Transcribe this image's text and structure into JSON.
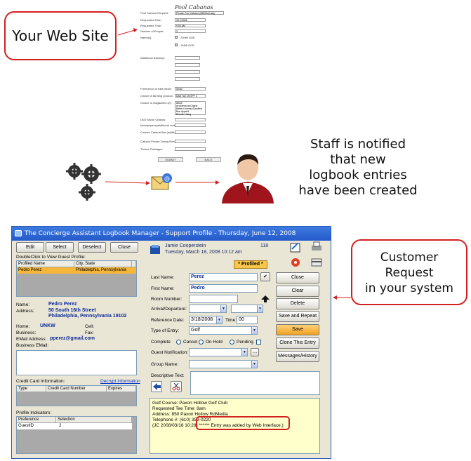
{
  "callouts": {
    "web_site": "Your Web Site",
    "staff_notice": [
      "Staff is notified",
      "that new",
      "logbook entries",
      "have been created"
    ],
    "customer_request": [
      "Customer",
      "Request",
      "in your system"
    ]
  },
  "webform": {
    "title": "Pool Cabanas",
    "fields": [
      {
        "label": "Pool Cabana Request:",
        "value": "Private Pool Cabana ($350/full day)"
      },
      {
        "label": "Requested Date:",
        "value": "3/17/2008"
      },
      {
        "label": "Requested Time:",
        "value": "9:00 AM"
      },
      {
        "label": "Number of People:",
        "value": "3"
      },
      {
        "label": "Name(s):",
        "value": "JOHN DOE"
      },
      {
        "label": "",
        "value": "JANE DOE"
      },
      {
        "label": "Additional Name(s):",
        "value": ""
      },
      {
        "label": "Preference of tribe mixer:",
        "value": "Small"
      },
      {
        "label": "Choice of tanning product:",
        "value": "Dark Tan Oil SPF 2"
      },
      {
        "label": "Choice of magazines (2):",
        "value": "Allure"
      },
      {
        "label": "DVD Movie Options:",
        "value": ""
      },
      {
        "label": "Newspapers(additional cost):",
        "value": ""
      },
      {
        "label": "Custom Cabana Bar (additional cost):",
        "value": ""
      },
      {
        "label": "Cabana Private Dining Menu:",
        "value": ""
      },
      {
        "label": "Theme Packages:",
        "value": ""
      }
    ],
    "magazines": [
      "Allure",
      "Architectural Digest",
      "Better Homes&Gardens",
      "Bon Appetit",
      "Bonnie Living"
    ],
    "submit_label": "SUBMIT",
    "back_label": "BACK"
  },
  "app": {
    "window_title": "The Concierge Assistant Logbook Manager - Support Profile - Thursday, June 12, 2008",
    "left": {
      "buttons": {
        "edit": "Edit",
        "select": "Select",
        "deselect": "Deselect",
        "close": "Close"
      },
      "profile_hint": "DoubleClick to View Guest Profile:",
      "profile_columns": [
        "Profiled Name",
        "City, State"
      ],
      "profile_rows": [
        {
          "name": "Pedro Perez",
          "city": "Philadelphia, Pennsylvania"
        }
      ],
      "name_label": "Name:",
      "name_value": "Pedro Perez",
      "address_label": "Address:",
      "address_line1": "50 South 16th Street",
      "address_line2": "Philadelphia, Pennsylvania   19102",
      "home_label": "Home:",
      "home_value": "UNKW",
      "cell_label": "Cell:",
      "business_label": "Business:",
      "fax_label": "Fax:",
      "email_label": "EMail Address:",
      "email_value": "pperez@gmail.com",
      "business_email_label": "Business EMail:",
      "cc_label": "Credit Card Information:",
      "cc_link": "Decrypt Information",
      "cc_columns": [
        "Type",
        "Credit Card Number",
        "Expires"
      ],
      "indicators_label": "Profile Indicators:",
      "indicator_columns": [
        "Preference",
        "Selection"
      ],
      "indicator_rows": [
        {
          "pref": "GuestID",
          "sel": "2"
        }
      ]
    },
    "right": {
      "user": "Jamie Cooperstein",
      "date": "Tuesday, March 18, 2008   10:12 am",
      "entry_number": "118",
      "profiled_badge": "* Profiled *",
      "last_name_label": "Last Name:",
      "last_name_value": "Perez",
      "first_name_label": "First Name:",
      "first_name_value": "Pedro",
      "room_label": "Room Number:",
      "arrival_label": "Arrival/Departure:",
      "ref_date_label": "Reference Date:",
      "ref_date_value": "3/18/2008",
      "time_label": "Time:",
      "time_value": "00",
      "type_label": "Type of Entry:",
      "type_value": "Golf",
      "complete_label": "Complete",
      "cancel_label": "Cancel",
      "onhold_label": "On Hold",
      "pending_label": "Pending",
      "guest_notif_label": "Guest Notification:",
      "group_label": "Group Name:",
      "desc_label": "Descriptive Text:",
      "buttons": [
        "Close",
        "Clear",
        "Delete",
        "Save and Repeat",
        "Save",
        "Clone This Entry",
        "Messages/History"
      ],
      "note_lines": [
        "Golf Course: Paxon Hollow Golf Club",
        "Requested Tee Time: 8am",
        "Address: 850 Paxon Hollow RdMedia",
        "Telephone #: (610) 353-0220",
        "(JC 2008/03/18 10:28) ****** Entry was added by Web Interface.)"
      ]
    }
  }
}
